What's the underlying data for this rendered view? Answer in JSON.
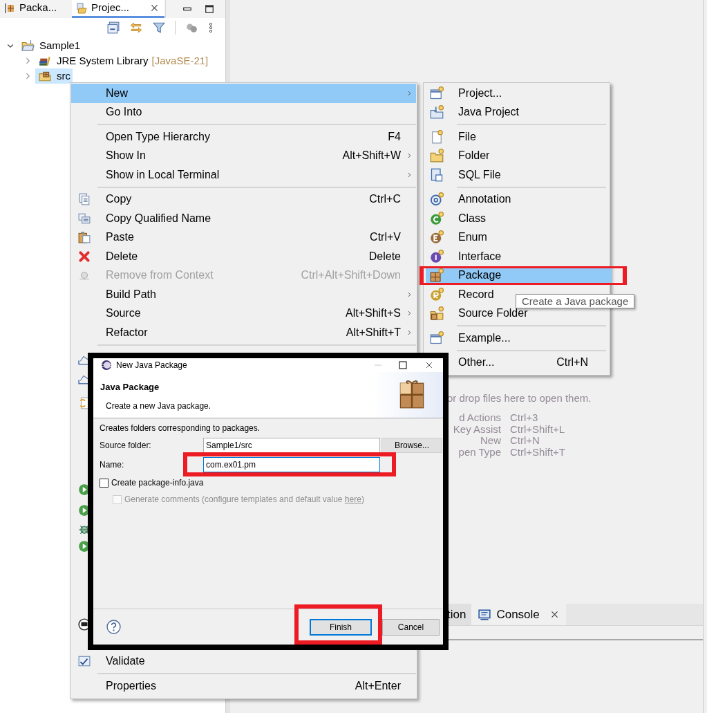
{
  "left_panel": {
    "tabs": [
      {
        "label": "Packa...",
        "selected": false,
        "closable": false
      },
      {
        "label": "Projec...",
        "selected": true,
        "closable": true
      }
    ],
    "tree": [
      {
        "label": "Sample1",
        "expanded": true,
        "selected": false,
        "children": [
          {
            "label": "JRE System Library",
            "suffix": "[JavaSE-21]",
            "expanded": false,
            "selected": false
          },
          {
            "label": "src",
            "expanded": false,
            "selected": true
          }
        ]
      }
    ]
  },
  "editor": {
    "hint": "or drop files here to open them.",
    "shortcuts": [
      {
        "action": "d Actions",
        "keys": "Ctrl+3"
      },
      {
        "action": "Key Assist",
        "keys": "Ctrl+Shift+L"
      },
      {
        "action": "New",
        "keys": "Ctrl+N"
      },
      {
        "action": "pen Type",
        "keys": "Ctrl+Shift+T"
      }
    ]
  },
  "bottom_tabs": [
    {
      "label": "tion",
      "selected": false,
      "closable": false
    },
    {
      "label": "Console",
      "selected": true,
      "closable": true
    }
  ],
  "context_menu": {
    "items": [
      {
        "kind": "item",
        "label": "New",
        "selected": true,
        "disabled": false,
        "submenu": true
      },
      {
        "kind": "item",
        "label": "Go Into",
        "selected": false,
        "disabled": false,
        "submenu": false
      },
      {
        "kind": "separator"
      },
      {
        "kind": "item",
        "label": "Open Type Hierarchy",
        "shortcut": "F4",
        "selected": false,
        "disabled": false,
        "submenu": false
      },
      {
        "kind": "item",
        "label": "Show In",
        "shortcut": "Alt+Shift+W",
        "selected": false,
        "disabled": false,
        "submenu": true
      },
      {
        "kind": "item",
        "label": "Show in Local Terminal",
        "selected": false,
        "disabled": false,
        "submenu": true
      },
      {
        "kind": "separator"
      },
      {
        "kind": "item",
        "label": "Copy",
        "shortcut": "Ctrl+C",
        "selected": false,
        "disabled": false,
        "submenu": false
      },
      {
        "kind": "item",
        "label": "Copy Qualified Name",
        "selected": false,
        "disabled": false,
        "submenu": false
      },
      {
        "kind": "item",
        "label": "Paste",
        "shortcut": "Ctrl+V",
        "selected": false,
        "disabled": false,
        "submenu": false
      },
      {
        "kind": "item",
        "label": "Delete",
        "shortcut": "Delete",
        "selected": false,
        "disabled": false,
        "submenu": false
      },
      {
        "kind": "item",
        "label": "Remove from Context",
        "shortcut": "Ctrl+Alt+Shift+Down",
        "selected": false,
        "disabled": true,
        "submenu": false
      },
      {
        "kind": "item",
        "label": "Build Path",
        "selected": false,
        "disabled": false,
        "submenu": true
      },
      {
        "kind": "item",
        "label": "Source",
        "shortcut": "Alt+Shift+S",
        "selected": false,
        "disabled": false,
        "submenu": true
      },
      {
        "kind": "item",
        "label": "Refactor",
        "shortcut": "Alt+Shift+T",
        "selected": false,
        "disabled": false,
        "submenu": true
      },
      {
        "kind": "separator"
      },
      {
        "kind": "obscured"
      },
      {
        "kind": "item",
        "label": "Validate",
        "selected": false,
        "disabled": false,
        "submenu": false
      },
      {
        "kind": "separator"
      },
      {
        "kind": "item",
        "label": "Properties",
        "shortcut": "Alt+Enter",
        "selected": false,
        "disabled": false,
        "submenu": false
      }
    ]
  },
  "submenu": {
    "items": [
      {
        "kind": "item",
        "label": "Project...",
        "selected": false,
        "highlighted": false
      },
      {
        "kind": "item",
        "label": "Java Project",
        "selected": false,
        "highlighted": false
      },
      {
        "kind": "separator"
      },
      {
        "kind": "item",
        "label": "File",
        "selected": false,
        "highlighted": false
      },
      {
        "kind": "item",
        "label": "Folder",
        "selected": false,
        "highlighted": false
      },
      {
        "kind": "item",
        "label": "SQL File",
        "selected": false,
        "highlighted": false
      },
      {
        "kind": "separator"
      },
      {
        "kind": "item",
        "label": "Annotation",
        "selected": false,
        "highlighted": false
      },
      {
        "kind": "item",
        "label": "Class",
        "selected": false,
        "highlighted": false
      },
      {
        "kind": "item",
        "label": "Enum",
        "selected": false,
        "highlighted": false
      },
      {
        "kind": "item",
        "label": "Interface",
        "selected": false,
        "highlighted": false
      },
      {
        "kind": "item",
        "label": "Package",
        "selected": true,
        "highlighted": true
      },
      {
        "kind": "item",
        "label": "Record",
        "selected": false,
        "highlighted": false
      },
      {
        "kind": "item",
        "label": "Source Folder",
        "selected": false,
        "highlighted": false
      },
      {
        "kind": "separator"
      },
      {
        "kind": "item",
        "label": "Example...",
        "selected": false,
        "highlighted": false
      },
      {
        "kind": "separator"
      },
      {
        "kind": "item",
        "label": "Other...",
        "shortcut": "Ctrl+N",
        "selected": false,
        "highlighted": false
      }
    ]
  },
  "tooltip": "Create a Java package",
  "dialog": {
    "title": "New Java Package",
    "heading": "Java Package",
    "description": "Create a new Java package.",
    "intro": "Creates folders corresponding to packages.",
    "fields": [
      {
        "label": "Source folder:",
        "value": "Sample1/src",
        "focused": false,
        "highlighted": false,
        "button": "Browse..."
      },
      {
        "label": "Name:",
        "value": "com.ex01.pm",
        "focused": true,
        "highlighted": true
      }
    ],
    "checkboxes": [
      {
        "label": "Create package-info.java",
        "checked": false,
        "disabled": false
      },
      {
        "label": "Generate comments (configure templates and default value ",
        "link": "here",
        "after": ")",
        "checked": false,
        "disabled": true
      }
    ],
    "buttons": [
      {
        "label": "Finish",
        "default": true,
        "highlighted": true
      },
      {
        "label": "Cancel",
        "default": false,
        "highlighted": false
      }
    ]
  }
}
